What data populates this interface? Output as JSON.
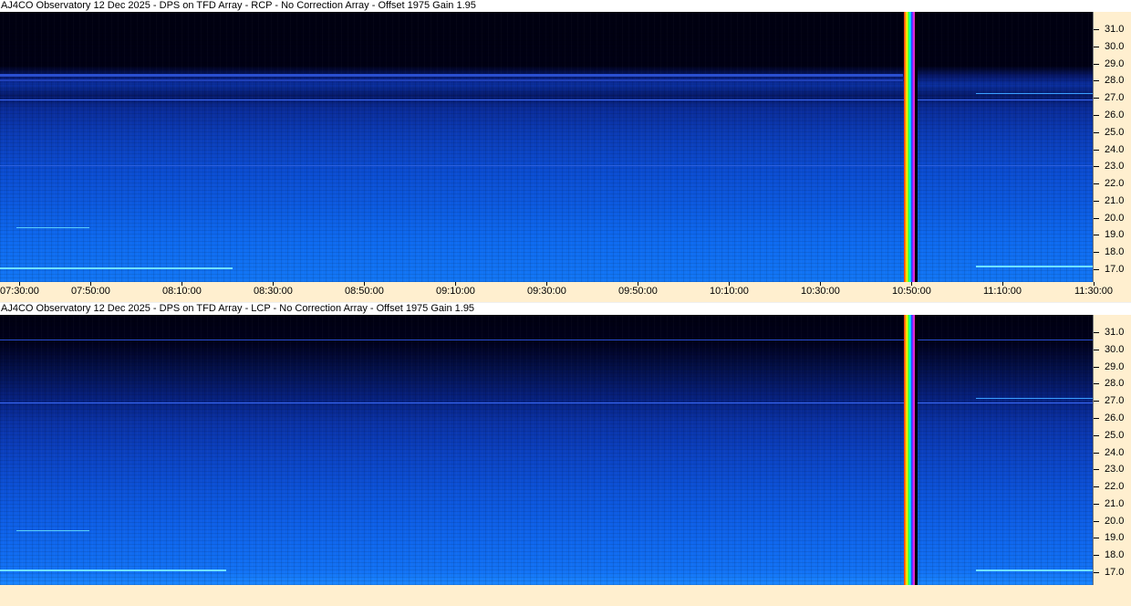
{
  "colors": {
    "axis_bg": "#ffefcf",
    "title_bg": "#ffffff",
    "spectrogram_dark": "#000018",
    "spectrogram_mid": "#0a3fb0",
    "spectrogram_bright": "#1a8cff"
  },
  "top": {
    "title": "AJ4CO Observatory 12 Dec 2025 - DPS on TFD Array  - RCP  -  No Correction Array  -  Offset 1975  Gain 1.95",
    "freq_labels": [
      "31.0",
      "30.0",
      "29.0",
      "28.0",
      "27.0",
      "26.0",
      "25.0",
      "24.0",
      "23.0",
      "22.0",
      "21.0",
      "20.0",
      "19.0",
      "18.0",
      "17.0"
    ],
    "time_labels": [
      "07:30:00",
      "07:50:00",
      "08:10:00",
      "08:30:00",
      "08:50:00",
      "09:10:00",
      "09:30:00",
      "09:50:00",
      "10:10:00",
      "10:30:00",
      "10:50:00",
      "11:10:00",
      "11:30:00"
    ]
  },
  "bottom": {
    "title": "AJ4CO Observatory 12 Dec 2025 - DPS on TFD Array  - LCP  -  No Correction Array  -  Offset 1975  Gain 1.95",
    "freq_labels": [
      "31.0",
      "30.0",
      "29.0",
      "28.0",
      "27.0",
      "26.0",
      "25.0",
      "24.0",
      "23.0",
      "22.0",
      "21.0",
      "20.0",
      "19.0",
      "18.0",
      "17.0"
    ]
  }
}
